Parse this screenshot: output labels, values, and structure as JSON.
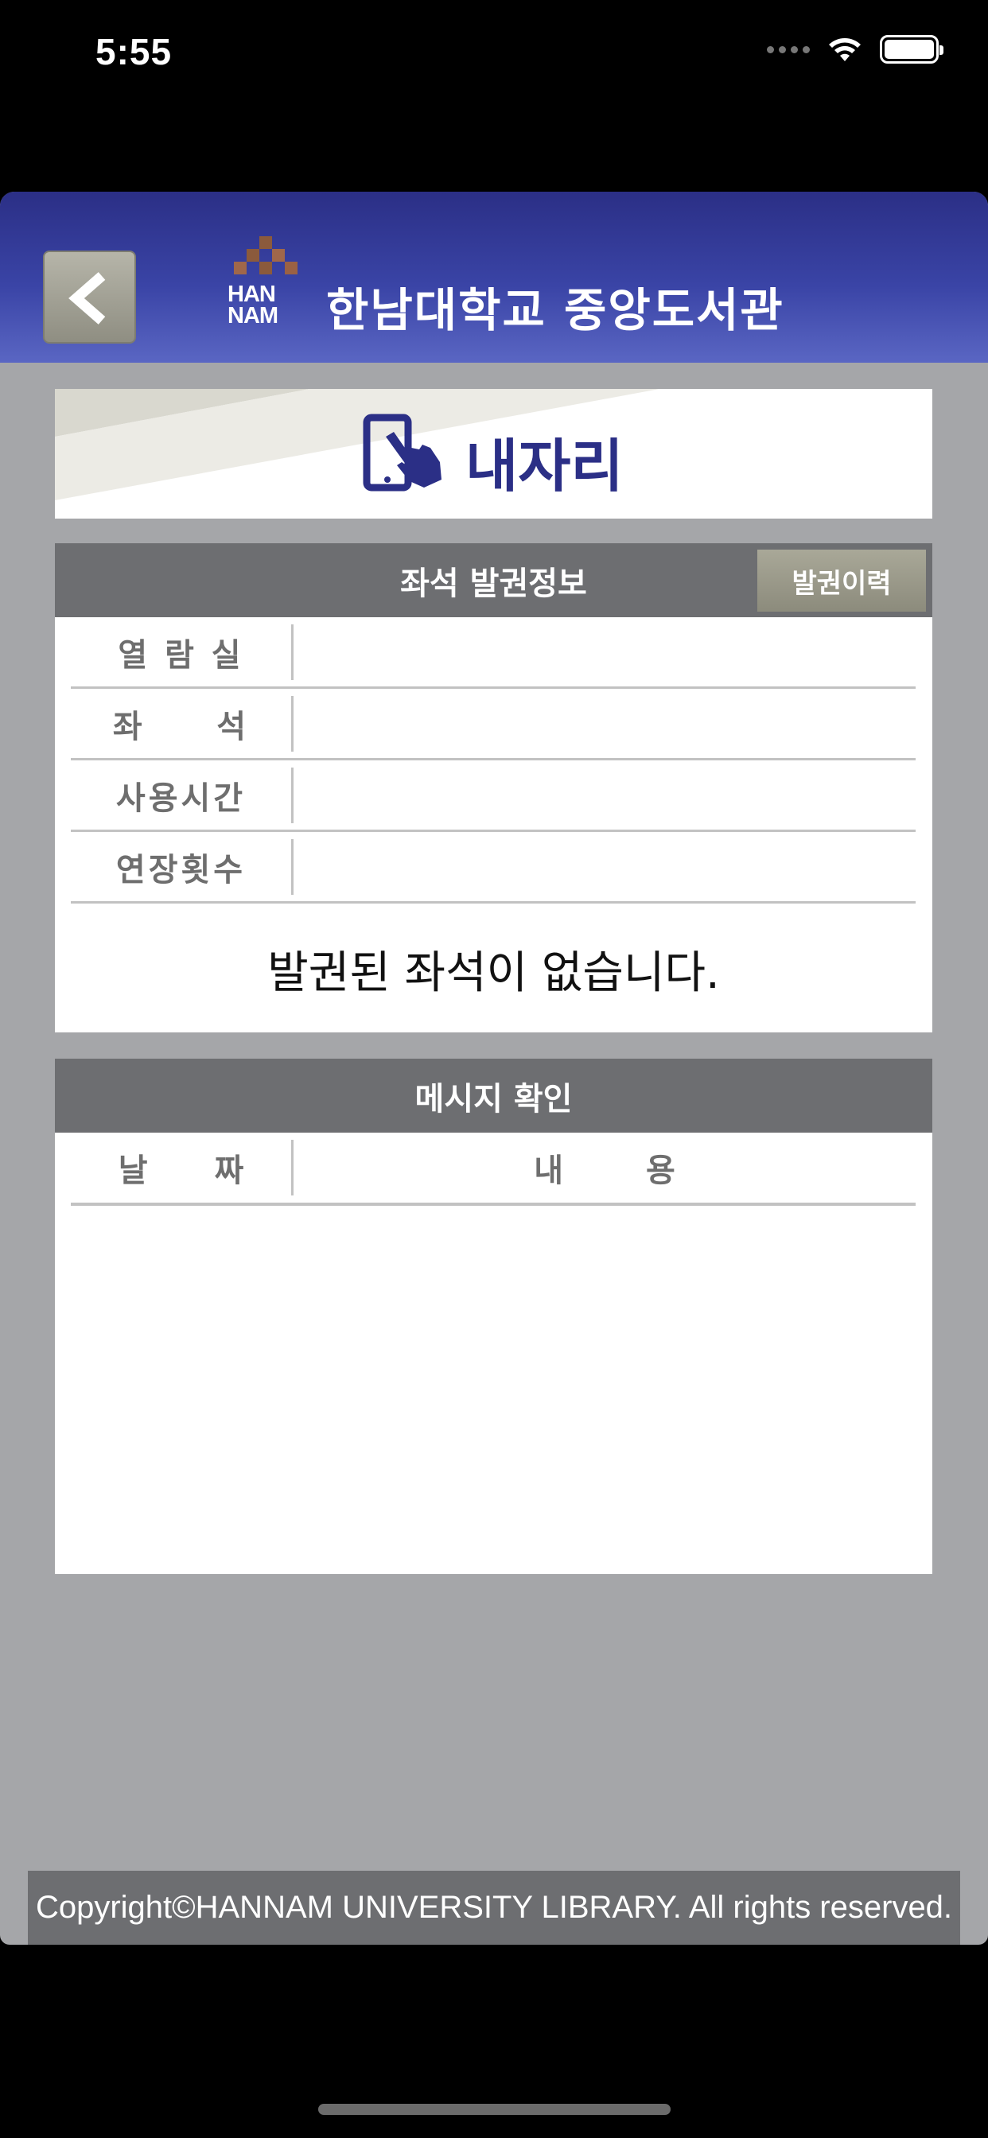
{
  "status_bar": {
    "time": "5:55"
  },
  "header": {
    "logo_text_top": "HAN",
    "logo_text_bottom": "NAM",
    "title": "한남대학교 중앙도서관"
  },
  "banner": {
    "title": "내자리"
  },
  "seat_panel": {
    "header": "좌석 발권정보",
    "history_button": "발권이력",
    "rows": [
      {
        "label": "열 람 실",
        "value": ""
      },
      {
        "label": "좌     석",
        "value": ""
      },
      {
        "label": "사용시간",
        "value": ""
      },
      {
        "label": "연장횟수",
        "value": ""
      }
    ],
    "empty_message": "발권된 좌석이 없습니다."
  },
  "message_panel": {
    "header": "메시지 확인",
    "col_date": "날 짜",
    "col_content": "내 용"
  },
  "footer": {
    "copyright": "Copyright©HANNAM UNIVERSITY LIBRARY. All rights reserved."
  },
  "colors": {
    "header_blue": "#2b2f86",
    "panel_header_gray": "#6d6e71",
    "background_gray": "#a5a6a9"
  }
}
